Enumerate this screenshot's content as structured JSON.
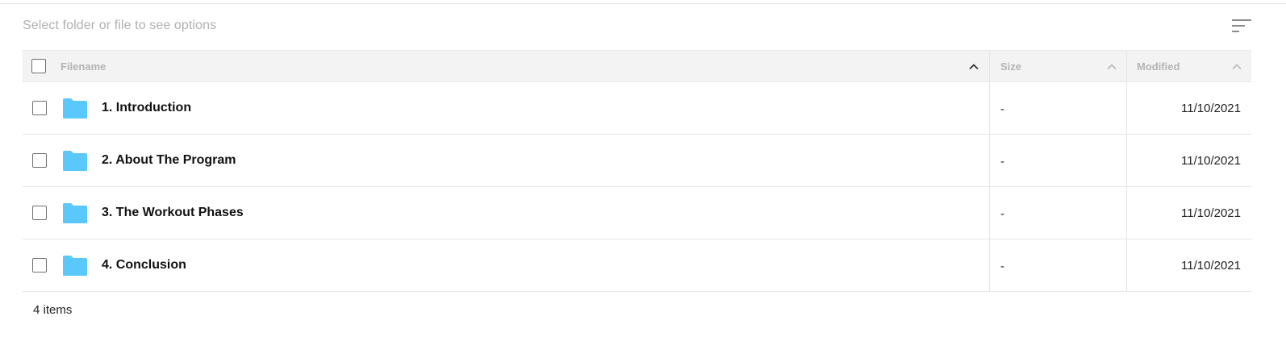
{
  "toolbar": {
    "hint": "Select folder or file to see options",
    "sort_icon": "sort-lines-icon"
  },
  "table": {
    "columns": {
      "filename": "Filename",
      "size": "Size",
      "modified": "Modified"
    },
    "rows": [
      {
        "name": "1. Introduction",
        "size": "-",
        "modified": "11/10/2021",
        "icon": "folder-icon"
      },
      {
        "name": "2. About The Program",
        "size": "-",
        "modified": "11/10/2021",
        "icon": "folder-icon"
      },
      {
        "name": "3. The Workout Phases",
        "size": "-",
        "modified": "11/10/2021",
        "icon": "folder-icon"
      },
      {
        "name": "4. Conclusion",
        "size": "-",
        "modified": "11/10/2021",
        "icon": "folder-icon"
      }
    ]
  },
  "footer": {
    "count": "4 items"
  },
  "colors": {
    "folder": "#5bc8fb",
    "header_bg": "#f3f3f3",
    "hint_text": "#b0b0b0"
  }
}
